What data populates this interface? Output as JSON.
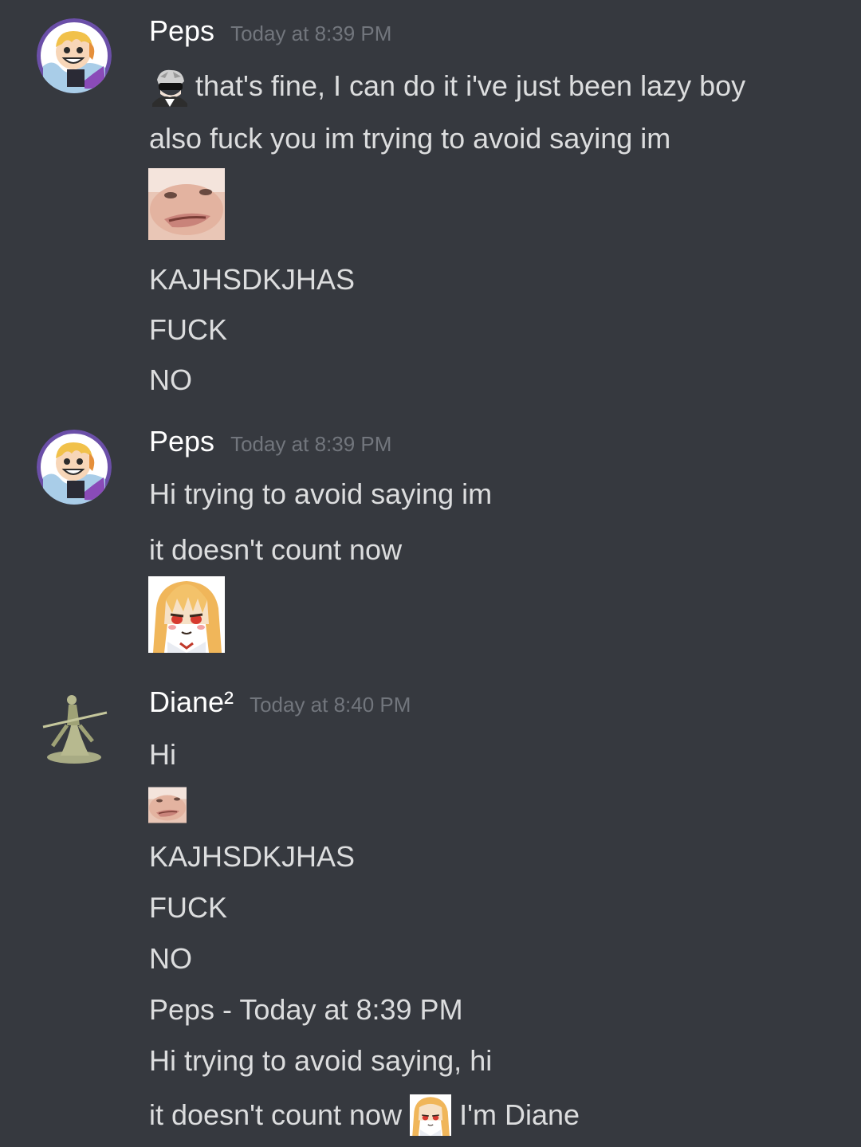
{
  "messages": [
    {
      "username": "Peps",
      "timestamp": "Today at 8:39 PM",
      "lines": {
        "l1": "that's fine, I can do it i've just been lazy boy",
        "l2": "also fuck you im trying to avoid saying im",
        "l3": "KAJHSDKJHAS",
        "l4": "FUCK",
        "l5": "NO"
      },
      "emojis": {
        "inline": "sunglasses-character-emoji",
        "big": "cat-face-emoji"
      }
    },
    {
      "username": "Peps",
      "timestamp": "Today at 8:39 PM",
      "lines": {
        "l1": "Hi trying to avoid saying im",
        "l2": "it doesn't count now"
      },
      "emojis": {
        "big": "anime-girl-smug-emoji"
      }
    },
    {
      "username": "Diane²",
      "timestamp": "Today at 8:40 PM",
      "lines": {
        "l1": "Hi",
        "l2": "KAJHSDKJHAS",
        "l3": "FUCK",
        "l4": "NO",
        "l5": "Peps - Today at 8:39 PM",
        "l6": "Hi trying to avoid saying, hi",
        "l7a": "it doesn't count now",
        "l7b": "I'm Diane"
      },
      "emojis": {
        "small": "cat-face-emoji",
        "inline": "anime-girl-smug-emoji"
      }
    }
  ],
  "colors": {
    "background": "#36393f",
    "username": "#ffffff",
    "timestamp": "#72767d",
    "text": "#dcddde"
  }
}
